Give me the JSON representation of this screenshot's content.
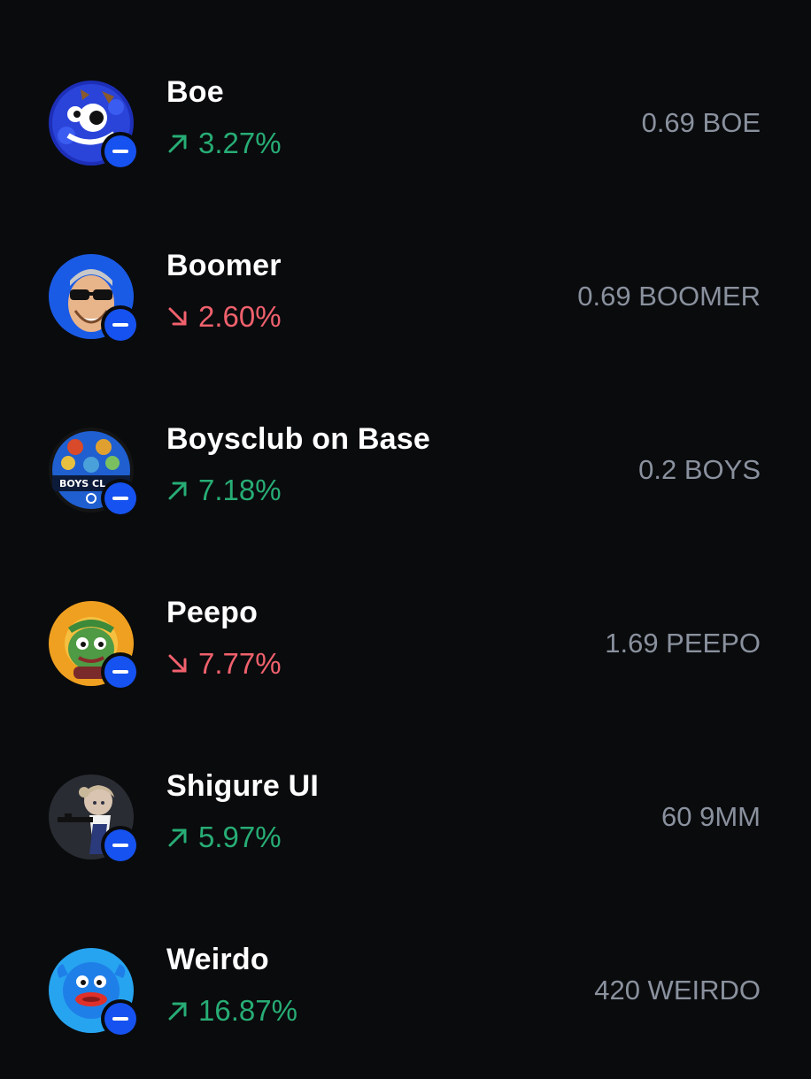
{
  "assets": [
    {
      "name": "Boe",
      "change": "3.27%",
      "direction": "up",
      "balance": "0.69 BOE",
      "avatar_icon": "boe-token-icon",
      "network_icon": "base-network-icon"
    },
    {
      "name": "Boomer",
      "change": "2.60%",
      "direction": "down",
      "balance": "0.69 BOOMER",
      "avatar_icon": "boomer-token-icon",
      "network_icon": "base-network-icon"
    },
    {
      "name": "Boysclub on Base",
      "change": "7.18%",
      "direction": "up",
      "balance": "0.2 BOYS",
      "avatar_icon": "boys-token-icon",
      "avatar_text": "BOYS CL",
      "network_icon": "base-network-icon"
    },
    {
      "name": "Peepo",
      "change": "7.77%",
      "direction": "down",
      "balance": "1.69 PEEPO",
      "avatar_icon": "peepo-token-icon",
      "network_icon": "base-network-icon"
    },
    {
      "name": "Shigure UI",
      "change": "5.97%",
      "direction": "up",
      "balance": "60 9MM",
      "avatar_icon": "9mm-token-icon",
      "network_icon": "base-network-icon"
    },
    {
      "name": "Weirdo",
      "change": "16.87%",
      "direction": "up",
      "balance": "420 WEIRDO",
      "avatar_icon": "weirdo-token-icon",
      "network_icon": "base-network-icon"
    }
  ],
  "colors": {
    "background": "#0a0b0d",
    "positive": "#27ad75",
    "negative": "#f0616d",
    "secondary_text": "#8a919e",
    "badge": "#1652f0"
  }
}
